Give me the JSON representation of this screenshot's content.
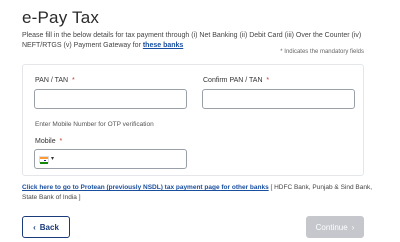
{
  "page": {
    "title": "e-Pay Tax",
    "intro_text": "Please fill in the below details for tax payment through (i) Net Banking (ii) Debit Card (iii) Over the Counter (iv) NEFT/RTGS (v) Payment Gateway for ",
    "intro_link": "these banks",
    "mandatory_note": "* Indicates the mandatory fields"
  },
  "form": {
    "pan_label": "PAN / TAN",
    "pan_value": "",
    "confirm_pan_label": "Confirm PAN / TAN",
    "confirm_pan_value": "",
    "required_mark": "*",
    "otp_hint": "Enter Mobile Number for OTP verification",
    "mobile_label": "Mobile",
    "mobile_value": "",
    "country_flag": "india-flag-icon",
    "country_caret": "▾"
  },
  "footer": {
    "protean_link": "Click here to go to Protean (previously NSDL) tax payment page for other banks",
    "banks_note": " [ HDFC Bank, Punjab & Sind Bank, State Bank of India ]"
  },
  "buttons": {
    "back_icon": "‹",
    "back_label": "Back",
    "continue_label": "Continue",
    "continue_icon": "›"
  },
  "colors": {
    "link": "#1a4fa0",
    "back_button": "#1a3a7a",
    "continue_disabled": "#c5c7cc",
    "required": "#c0392b"
  }
}
